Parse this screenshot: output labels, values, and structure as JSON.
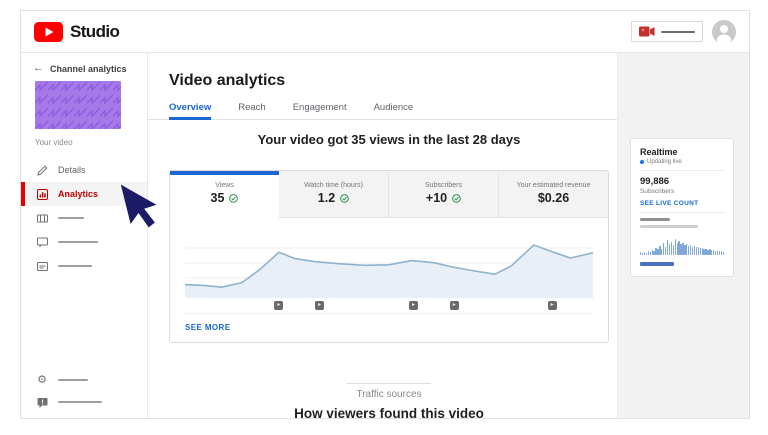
{
  "colors": {
    "accent_blue": "#1967d2",
    "brand_red": "#ff0000",
    "analytics_red": "#c00000",
    "green_check": "#188038",
    "chart_line": "#8fb2cd",
    "chart_fill": "#e8eff6",
    "realtime_bar_blue": "#7fa8d9",
    "thumbnail_purple": "#a678e8"
  },
  "topbar": {
    "brand": "Studio"
  },
  "sidebar": {
    "back_label": "Channel analytics",
    "video_label": "Your video",
    "items": [
      {
        "icon": "pencil-icon",
        "label": "Details",
        "active": false
      },
      {
        "icon": "analytics-icon",
        "label": "Analytics",
        "active": true
      },
      {
        "icon": "editor-icon",
        "label": "",
        "placeholder": true
      },
      {
        "icon": "comments-icon",
        "label": "",
        "placeholder": true
      },
      {
        "icon": "subtitles-icon",
        "label": "",
        "placeholder": true
      }
    ],
    "footer_items": [
      {
        "icon": "gear-icon",
        "placeholder": true
      },
      {
        "icon": "feedback-icon",
        "placeholder": true
      }
    ]
  },
  "main": {
    "title": "Video analytics",
    "tabs": [
      {
        "label": "Overview",
        "active": true
      },
      {
        "label": "Reach",
        "active": false
      },
      {
        "label": "Engagement",
        "active": false
      },
      {
        "label": "Audience",
        "active": false
      }
    ],
    "headline": "Your video got 35 views in the last 28 days",
    "stats": [
      {
        "label": "Views",
        "value": "35",
        "verified": true,
        "active": true
      },
      {
        "label": "Watch time (hours)",
        "value": "1.2",
        "verified": true,
        "active": false
      },
      {
        "label": "Subscribers",
        "value": "+10",
        "verified": true,
        "active": false
      },
      {
        "label": "Your estimated revenue",
        "value": "$0.26",
        "verified": false,
        "active": false
      }
    ],
    "see_more": "SEE MORE",
    "traffic_label": "Traffic sources",
    "section_heading": "How viewers found this video"
  },
  "realtime": {
    "title": "Realtime",
    "updating": "Updating live",
    "count": "99,886",
    "count_label": "Subscribers",
    "live_count_link": "SEE LIVE COUNT"
  },
  "chart_data": [
    {
      "type": "area",
      "title": "Your video got 35 views in the last 28 days",
      "xlabel": "",
      "ylabel": "",
      "axis_tick_labels_visible": false,
      "x_range_days": 28,
      "ylim": [
        0,
        100
      ],
      "grid": "horizontal",
      "x_fraction": [
        0,
        0.05,
        0.09,
        0.14,
        0.185,
        0.23,
        0.27,
        0.32,
        0.38,
        0.44,
        0.5,
        0.555,
        0.61,
        0.66,
        0.71,
        0.76,
        0.8,
        0.855,
        0.9,
        0.945,
        1.0
      ],
      "values": [
        22,
        20,
        17,
        26,
        52,
        84,
        72,
        66,
        62,
        59,
        60,
        68,
        64,
        55,
        48,
        42,
        58,
        98,
        85,
        73,
        83
      ],
      "video_markers_x_fraction": [
        0.23,
        0.33,
        0.56,
        0.66,
        0.9
      ]
    },
    {
      "type": "bar",
      "ylim": [
        0,
        100
      ],
      "values": [
        12,
        8,
        15,
        10,
        20,
        14,
        25,
        18,
        35,
        26,
        44,
        30,
        58,
        38,
        72,
        52,
        64,
        46,
        78,
        58,
        68,
        52,
        60,
        48,
        54,
        44,
        50,
        40,
        44,
        36,
        40,
        32,
        34,
        28,
        30,
        24,
        26,
        22,
        22,
        18,
        20,
        16,
        16,
        14
      ]
    }
  ]
}
